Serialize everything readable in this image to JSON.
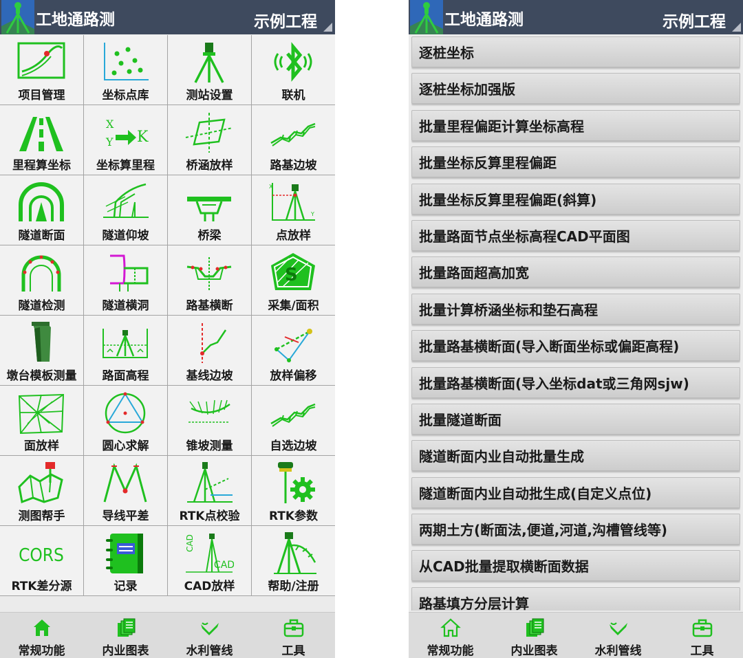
{
  "left_screen": {
    "header": {
      "title": "工地通路测",
      "project": "示例工程"
    },
    "grid": [
      {
        "label": "项目管理",
        "icon": "project-management-icon"
      },
      {
        "label": "坐标点库",
        "icon": "point-library-icon"
      },
      {
        "label": "测站设置",
        "icon": "station-setup-icon"
      },
      {
        "label": "联机",
        "icon": "bluetooth-icon"
      },
      {
        "label": "里程算坐标",
        "icon": "road-lanes-icon"
      },
      {
        "label": "坐标算里程",
        "icon": "xy-to-k-icon"
      },
      {
        "label": "桥涵放样",
        "icon": "culvert-icon"
      },
      {
        "label": "路基边坡",
        "icon": "slope-icon"
      },
      {
        "label": "隧道断面",
        "icon": "tunnel-section-icon"
      },
      {
        "label": "隧道仰坡",
        "icon": "tunnel-slope-icon"
      },
      {
        "label": "桥梁",
        "icon": "bridge-icon"
      },
      {
        "label": "点放样",
        "icon": "point-stakeout-icon"
      },
      {
        "label": "隧道检测",
        "icon": "tunnel-inspection-icon"
      },
      {
        "label": "隧道横洞",
        "icon": "tunnel-adit-icon"
      },
      {
        "label": "路基横断",
        "icon": "cross-section-icon"
      },
      {
        "label": "采集/面积",
        "icon": "collect-area-icon"
      },
      {
        "label": "墩台模板测量",
        "icon": "pier-formwork-icon"
      },
      {
        "label": "路面高程",
        "icon": "pavement-elevation-icon"
      },
      {
        "label": "基线边坡",
        "icon": "baseline-slope-icon"
      },
      {
        "label": "放样偏移",
        "icon": "stakeout-offset-icon"
      },
      {
        "label": "面放样",
        "icon": "surface-stakeout-icon"
      },
      {
        "label": "圆心求解",
        "icon": "circle-center-icon"
      },
      {
        "label": "锥坡测量",
        "icon": "cone-slope-icon"
      },
      {
        "label": "自选边坡",
        "icon": "custom-slope-icon"
      },
      {
        "label": "测图帮手",
        "icon": "mapping-helper-icon"
      },
      {
        "label": "导线平差",
        "icon": "traverse-adjustment-icon"
      },
      {
        "label": "RTK点校验",
        "icon": "rtk-point-check-icon"
      },
      {
        "label": "RTK参数",
        "icon": "rtk-params-icon"
      },
      {
        "label": "RTK差分源",
        "icon": "cors-icon",
        "icon_text": "CORS"
      },
      {
        "label": "记录",
        "icon": "notebook-icon"
      },
      {
        "label": "CAD放样",
        "icon": "cad-stakeout-icon",
        "icon_text_top": "CAD",
        "icon_text_bottom": "CAD"
      },
      {
        "label": "帮助/注册",
        "icon": "help-register-icon"
      }
    ],
    "nav": [
      {
        "label": "常规功能",
        "icon": "home-icon"
      },
      {
        "label": "内业图表",
        "icon": "documents-icon"
      },
      {
        "label": "水利管线",
        "icon": "water-pipeline-icon"
      },
      {
        "label": "工具",
        "icon": "toolbox-icon"
      }
    ]
  },
  "right_screen": {
    "header": {
      "title": "工地通路测",
      "project": "示例工程"
    },
    "list": [
      "逐桩坐标",
      "逐桩坐标加强版",
      "批量里程偏距计算坐标高程",
      "批量坐标反算里程偏距",
      "批量坐标反算里程偏距(斜算)",
      "批量路面节点坐标高程CAD平面图",
      "批量路面超高加宽",
      "批量计算桥涵坐标和垫石高程",
      "批量路基横断面(导入断面坐标或偏距高程)",
      "批量路基横断面(导入坐标dat或三角网sjw)",
      "批量隧道断面",
      "隧道断面内业自动批量生成",
      "隧道断面内业自动批生成(自定义点位)",
      "两期土方(断面法,便道,河道,沟槽管线等)",
      "从CAD批量提取横断面数据",
      "路基填方分层计算"
    ],
    "nav": [
      {
        "label": "常规功能",
        "icon": "home-icon"
      },
      {
        "label": "内业图表",
        "icon": "documents-icon"
      },
      {
        "label": "水利管线",
        "icon": "water-pipeline-icon"
      },
      {
        "label": "工具",
        "icon": "toolbox-icon"
      }
    ]
  },
  "colors": {
    "header": "#3e4a5e",
    "icon_green": "#1fc01f",
    "dark_green": "#0b7a0b",
    "accent_red": "#e32a2a",
    "magenta": "#d318d3"
  }
}
